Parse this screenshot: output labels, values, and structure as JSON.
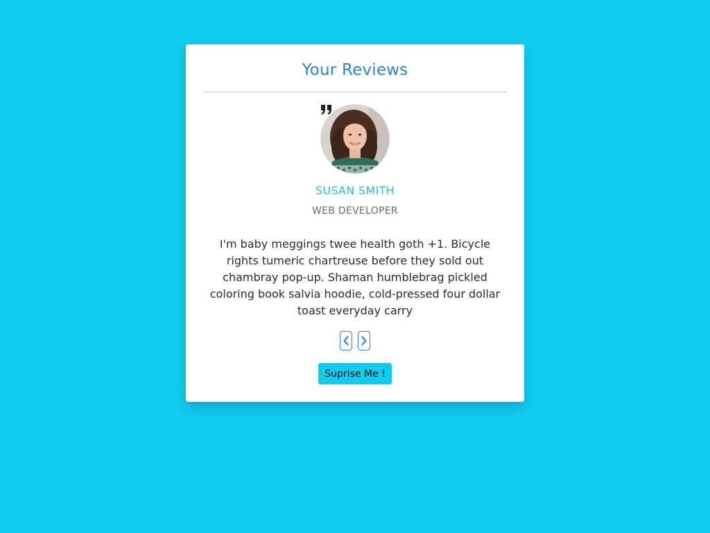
{
  "card": {
    "title": "Your Reviews"
  },
  "review": {
    "name": "SUSAN SMITH",
    "job": "WEB DEVELOPER",
    "text": "I'm baby meggings twee health goth +1. Bicycle rights tumeric chartreuse before they sold out chambray pop-up. Shaman humblebrag pickled coloring book salvia hoodie, cold-pressed four dollar toast everyday carry"
  },
  "controls": {
    "prev_icon": "chevron-left-icon",
    "next_icon": "chevron-right-icon",
    "surprise_label": "Suprise Me !"
  },
  "colors": {
    "background": "#11ccf1",
    "title": "#2a82d6",
    "name": "#17c3e0",
    "button": "#11ccf1"
  }
}
